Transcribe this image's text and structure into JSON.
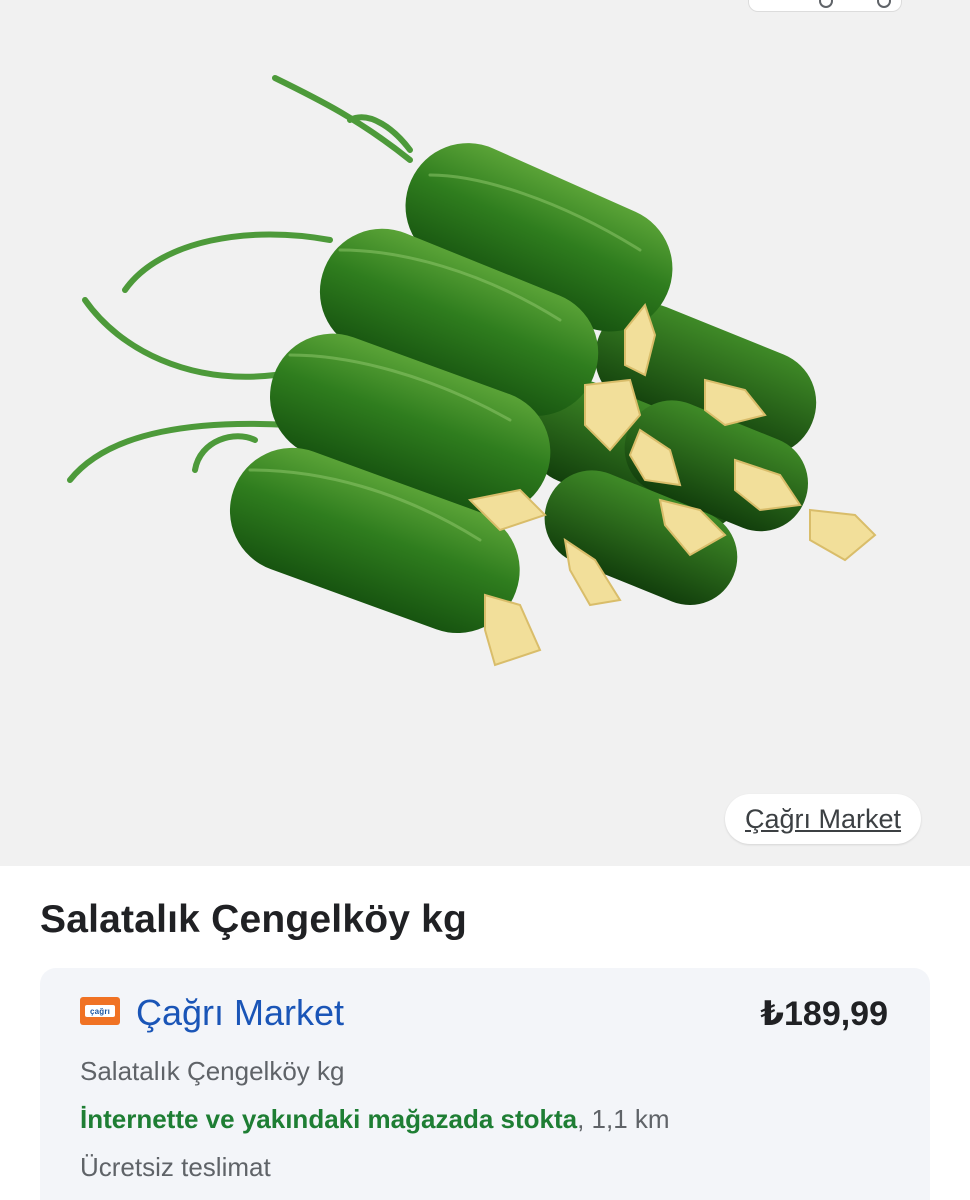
{
  "product": {
    "title": "Salatalık Çengelköy kg",
    "image_icon": "cucumber-image",
    "source_chip": "Çağrı Market"
  },
  "offer": {
    "store_name": "Çağrı Market",
    "store_logo_icon": "cagri-market-logo",
    "store_logo_text": "çağrı",
    "price": "₺189,99",
    "subtitle": "Salatalık Çengelköy kg",
    "stock_text": "İnternette ve yakındaki mağazada stokta",
    "distance": ", 1,1 km",
    "delivery": "Ücretsiz teslimat"
  },
  "colors": {
    "link_blue": "#1a55b7",
    "stock_green": "#1e7e34",
    "logo_orange": "#f07224"
  }
}
